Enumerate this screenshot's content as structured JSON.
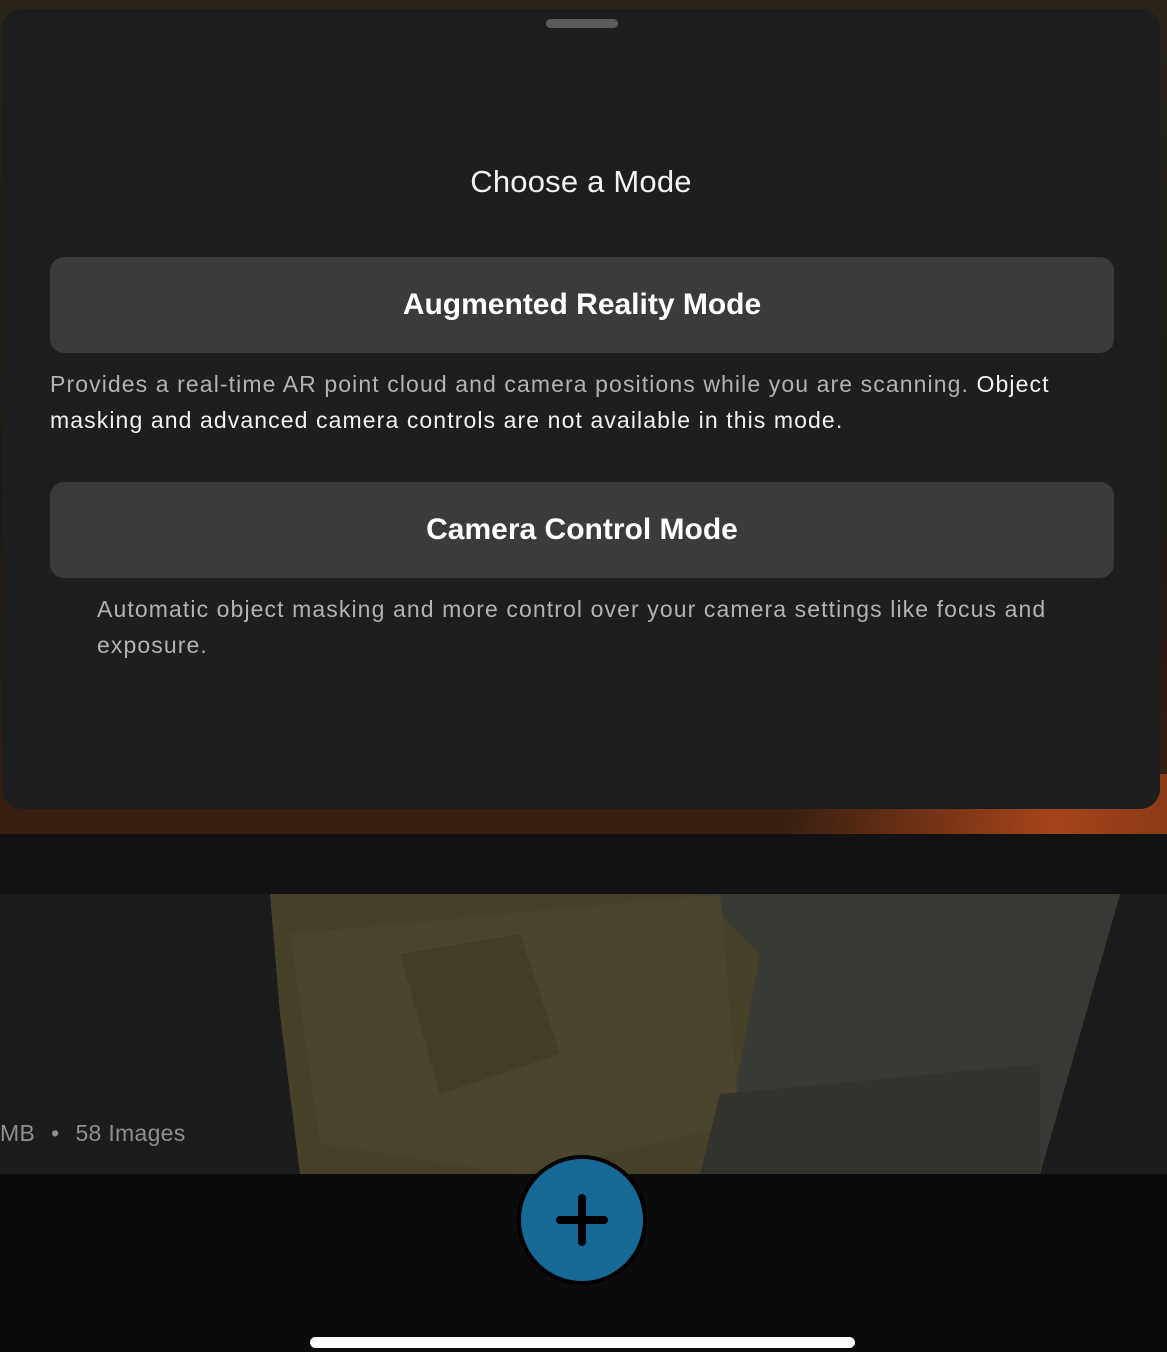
{
  "sheet": {
    "title": "Choose a Mode",
    "ar_mode": {
      "label": "Augmented Reality Mode",
      "description_lead": "Provides a real-time AR point cloud and camera positions while you are scanning.",
      "description_emphasis": "Object masking and advanced camera controls are not available in this mode."
    },
    "camera_control_mode": {
      "label": "Camera Control Mode",
      "description": "Automatic object masking and more control over your camera settings like focus and exposure."
    }
  },
  "background": {
    "scan_card": {
      "size_fragment": "MB",
      "separator": "•",
      "image_count": "58 Images"
    }
  },
  "bottom_bar": {
    "add_button_icon": "plus-icon",
    "accent_color": "#176a98"
  }
}
